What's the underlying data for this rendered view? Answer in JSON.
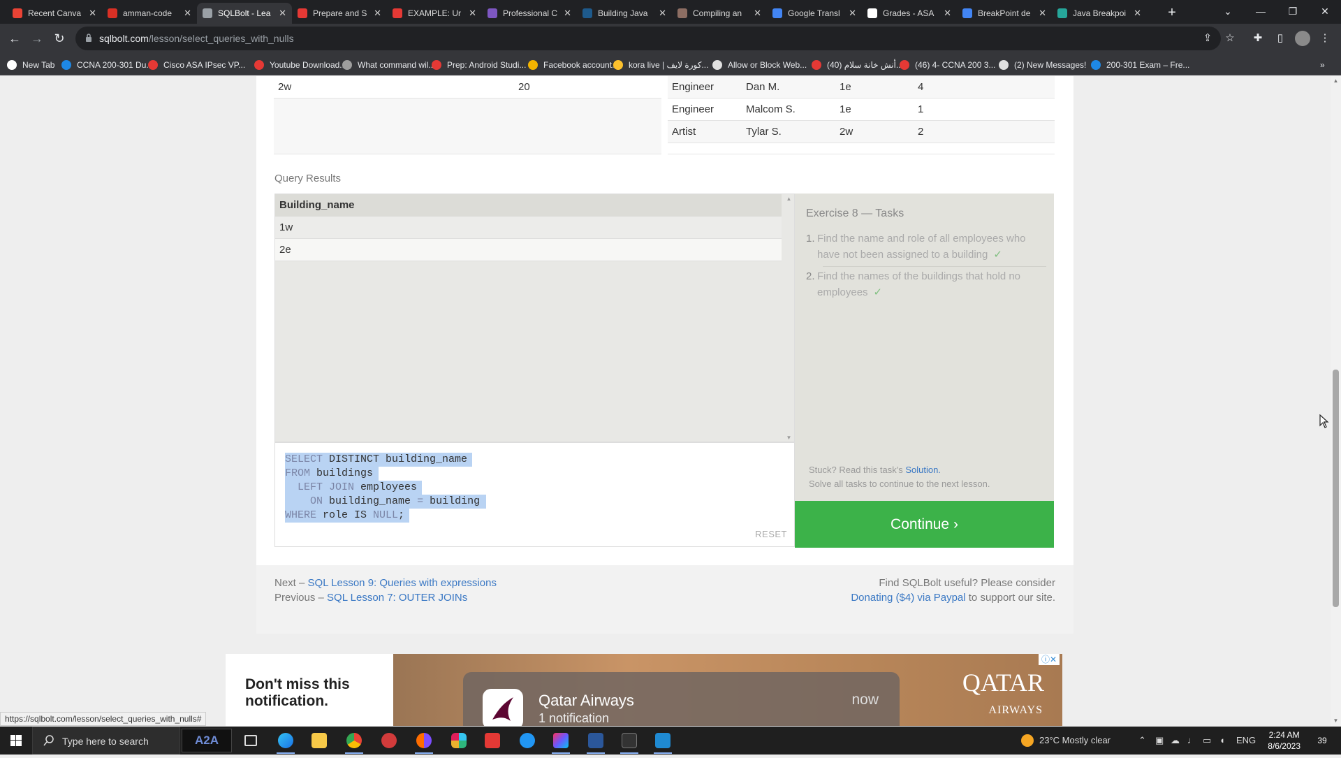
{
  "browser": {
    "tabs": [
      {
        "label": "Recent Canva",
        "color": "#ea4335"
      },
      {
        "label": "amman-code",
        "color": "#d93025"
      },
      {
        "label": "SQLBolt - Lea",
        "color": "#9aa0a6"
      },
      {
        "label": "Prepare and S",
        "color": "#e53935"
      },
      {
        "label": "EXAMPLE: Ur",
        "color": "#e53935"
      },
      {
        "label": "Professional C",
        "color": "#7e57c2"
      },
      {
        "label": "Building Java",
        "color": "#1e5a8c"
      },
      {
        "label": "Compiling an",
        "color": "#8d6e63"
      },
      {
        "label": "Google Transl",
        "color": "#4285f4"
      },
      {
        "label": "Grades - ASA",
        "color": "#ffffff"
      },
      {
        "label": "BreakPoint de",
        "color": "#4285f4"
      },
      {
        "label": "Java Breakpoi",
        "color": "#26a69a"
      }
    ],
    "active_tab_index": 2,
    "url_host": "sqlbolt.com",
    "url_path": "/lesson/select_queries_with_nulls",
    "bookmarks": [
      {
        "label": "New Tab",
        "color": "#ffffff"
      },
      {
        "label": "CCNA 200-301 Du...",
        "color": "#1e88e5"
      },
      {
        "label": "Cisco ASA IPsec VP...",
        "color": "#e53935"
      },
      {
        "label": "Youtube Download...",
        "color": "#e53935"
      },
      {
        "label": "What command wil...",
        "color": "#9e9e9e"
      },
      {
        "label": "Prep: Android Studi...",
        "color": "#e53935"
      },
      {
        "label": "Facebook account...",
        "color": "#f4b400"
      },
      {
        "label": "kora live | كورة لايف...",
        "color": "#fbc02d"
      },
      {
        "label": "Allow or Block Web...",
        "color": "#e0e0e0"
      },
      {
        "label": "(40) أنش خانة سلام...",
        "color": "#e53935"
      },
      {
        "label": "(46) 4- CCNA 200 3...",
        "color": "#e53935"
      },
      {
        "label": "(2) New Messages!",
        "color": "#e0e0e0"
      },
      {
        "label": "200-301 Exam – Fre...",
        "color": "#1e88e5"
      }
    ]
  },
  "tables": {
    "left": [
      {
        "c1": "2w",
        "c2": "20"
      }
    ],
    "right": [
      {
        "role": "Engineer",
        "name": "Dan M.",
        "building": "1e",
        "years": "4"
      },
      {
        "role": "Engineer",
        "name": "Malcom S.",
        "building": "1e",
        "years": "1"
      },
      {
        "role": "Artist",
        "name": "Tylar S.",
        "building": "2w",
        "years": "2"
      }
    ]
  },
  "results": {
    "label": "Query Results",
    "column": "Building_name",
    "rows": [
      "1w",
      "2e"
    ]
  },
  "editor": {
    "reset_label": "RESET"
  },
  "tasks": {
    "title": "Exercise 8 — Tasks",
    "items": [
      {
        "num": "1.",
        "text": "Find the name and role of all employees who have not been assigned to a building"
      },
      {
        "num": "2.",
        "text": "Find the names of the buildings that hold no employees"
      }
    ],
    "check_mark": "✓",
    "stuck_prefix": "Stuck? Read this task's ",
    "solution_link": "Solution.",
    "solve_all": "Solve all tasks to continue to the next lesson."
  },
  "continue_label": "Continue ›",
  "footer": {
    "next_prefix": "Next – ",
    "next_link": "SQL Lesson 9: Queries with expressions",
    "prev_prefix": "Previous – ",
    "prev_link": "SQL Lesson 7: OUTER JOINs",
    "useful": "Find SQLBolt useful? Please consider",
    "donate_link": "Donating ($4) via Paypal",
    "donate_suffix": " to support our site."
  },
  "ad": {
    "headline": "Don't miss this notification.",
    "notif_title": "Qatar Airways",
    "notif_sub": "1 notification",
    "notif_time": "now",
    "brand_main": "QATAR",
    "brand_sub": "AIRWAYS"
  },
  "status_url": "https://sqlbolt.com/lesson/select_queries_with_nulls#",
  "taskbar": {
    "search_placeholder": "Type here to search",
    "a2a_label": "A2A",
    "weather": "23°C  Mostly clear",
    "lang": "ENG",
    "time": "2:24 AM",
    "date": "8/6/2023",
    "notifications": "39"
  }
}
